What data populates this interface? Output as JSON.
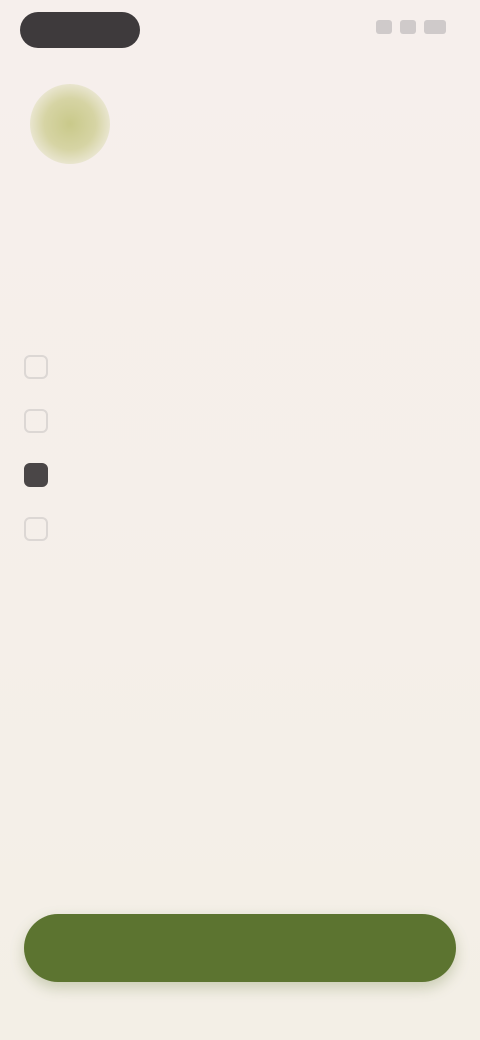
{
  "status_bar": {
    "time": "",
    "icons": [
      "signal-icon",
      "wifi-icon",
      "battery-icon"
    ]
  },
  "header": {
    "logo_icon": "leaf-logo-icon",
    "title": ""
  },
  "options": [
    {
      "label": "",
      "checked": false
    },
    {
      "label": "",
      "checked": false
    },
    {
      "label": "",
      "checked": true
    },
    {
      "label": "",
      "checked": false
    }
  ],
  "other_link": "",
  "cta": {
    "label": ""
  },
  "colors": {
    "background": "#f6efec",
    "accent": "#5c7430",
    "logo": "#c9c98a",
    "status_pill": "#3e3a3c"
  }
}
